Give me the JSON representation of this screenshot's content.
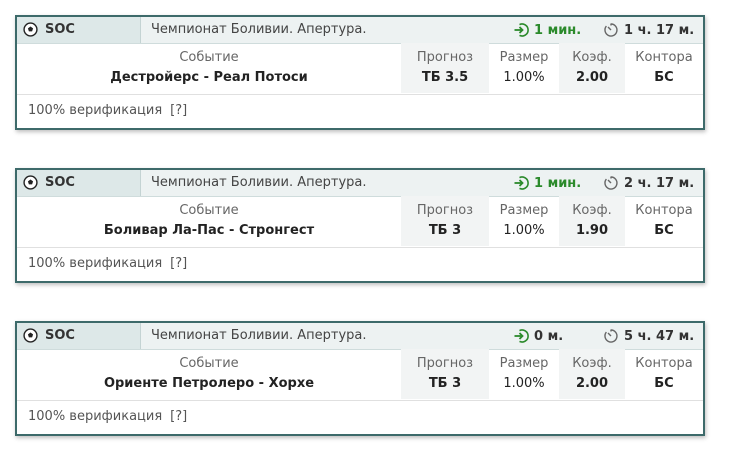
{
  "columns": {
    "event": "Событие",
    "forecast": "Прогноз",
    "size": "Размер",
    "odds": "Коэф.",
    "bookie": "Контора"
  },
  "icons": {
    "sport": "soccer-ball-icon",
    "arrow_in": "arrow-in-circle-icon",
    "timer": "stopwatch-icon"
  },
  "colors": {
    "border": "#3d6a6a",
    "green": "#2b8a2b"
  },
  "cards": [
    {
      "sport": "SOC",
      "league": "Чемпионат Боливии. Апертура.",
      "published": "1 мин.",
      "starts_in": "1 ч. 17 м.",
      "event": "Дестройерс - Реал Потоси",
      "forecast": "ТБ 3.5",
      "size": "1.00%",
      "odds": "2.00",
      "bookie": "БС",
      "verification": "100% верификация",
      "help": "[?]"
    },
    {
      "sport": "SOC",
      "league": "Чемпионат Боливии. Апертура.",
      "published": "1 мин.",
      "starts_in": "2 ч. 17 м.",
      "event": "Боливар Ла-Пас - Стронгест",
      "forecast": "ТБ 3",
      "size": "1.00%",
      "odds": "1.90",
      "bookie": "БС",
      "verification": "100% верификация",
      "help": "[?]"
    },
    {
      "sport": "SOC",
      "league": "Чемпионат Боливии. Апертура.",
      "published": "0 м.",
      "starts_in": "5 ч. 47 м.",
      "event": "Ориенте Петролеро - Хорхе",
      "forecast": "ТБ 3",
      "size": "1.00%",
      "odds": "2.00",
      "bookie": "БС",
      "verification": "100% верификация",
      "help": "[?]"
    }
  ]
}
